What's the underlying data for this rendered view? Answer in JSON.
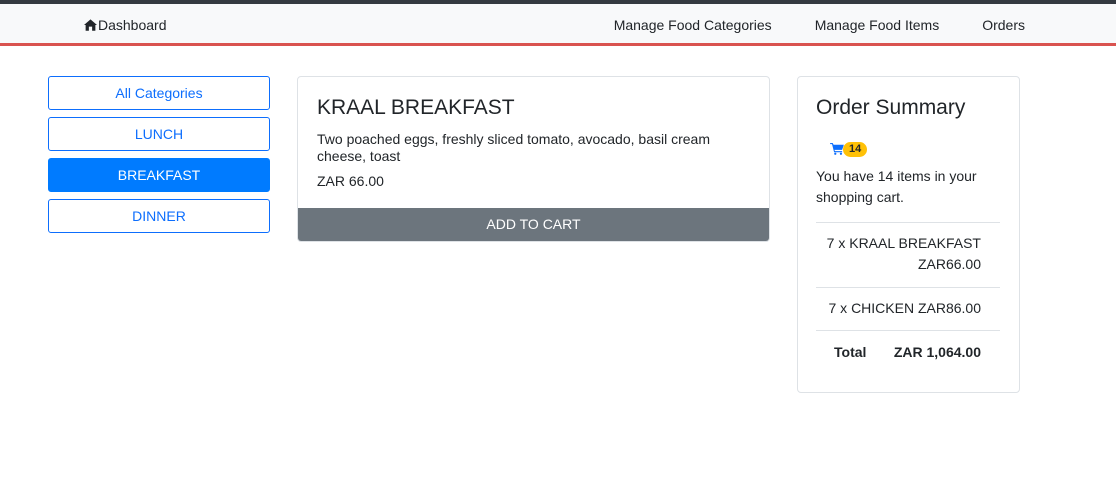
{
  "navbar": {
    "brand": "Dashboard",
    "links": [
      "Manage Food Categories",
      "Manage Food Items",
      "Orders"
    ]
  },
  "categories": {
    "items": [
      "All Categories",
      "LUNCH",
      "BREAKFAST",
      "DINNER"
    ],
    "active": "BREAKFAST"
  },
  "product": {
    "title": "KRAAL BREAKFAST",
    "description": "Two poached eggs, freshly sliced tomato, avocado, basil cream cheese, toast",
    "price": "ZAR 66.00",
    "add_label": "ADD TO CART"
  },
  "summary": {
    "title": "Order Summary",
    "cart_count": "14",
    "cart_text": "You have 14 items in your shopping cart.",
    "items": [
      {
        "line1": "7 x KRAAL BREAKFAST",
        "line2": "ZAR66.00"
      },
      {
        "line1": "7 x CHICKEN ZAR86.00",
        "line2": ""
      }
    ],
    "total_label": "Total",
    "total_value": "ZAR 1,064.00"
  },
  "colors": {
    "primary": "#007bff",
    "secondary": "#6c757d",
    "warning": "#ffc107",
    "nav_border": "#d9534f"
  }
}
